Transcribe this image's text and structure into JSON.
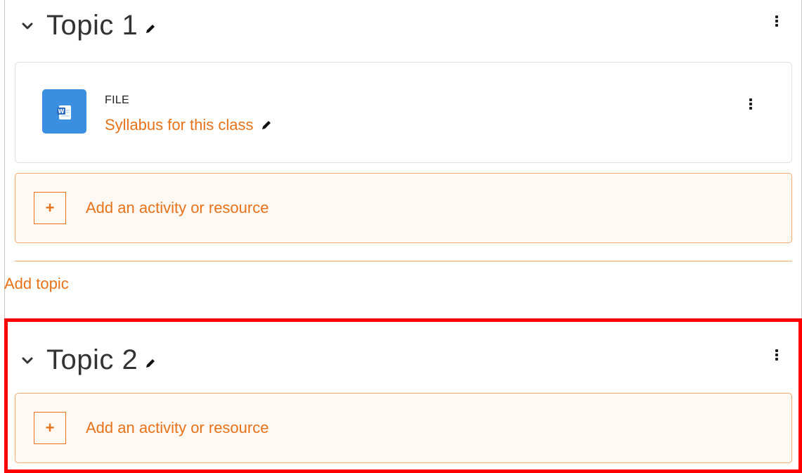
{
  "topic1": {
    "title": "Topic 1",
    "activity": {
      "type": "FILE",
      "name": "Syllabus for this class",
      "icon": "word-document-icon"
    },
    "add_activity_label": "Add an activity or resource",
    "add_icon": "+"
  },
  "add_topic_label": "Add topic",
  "topic2": {
    "title": "Topic 2",
    "add_activity_label": "Add an activity or resource",
    "add_icon": "+"
  },
  "colors": {
    "accent": "#e8721a",
    "add_box_bg": "#fff8f3",
    "add_box_border": "#f2a86b",
    "file_icon_bg": "#3a8fe0",
    "highlight": "#ff0000"
  }
}
